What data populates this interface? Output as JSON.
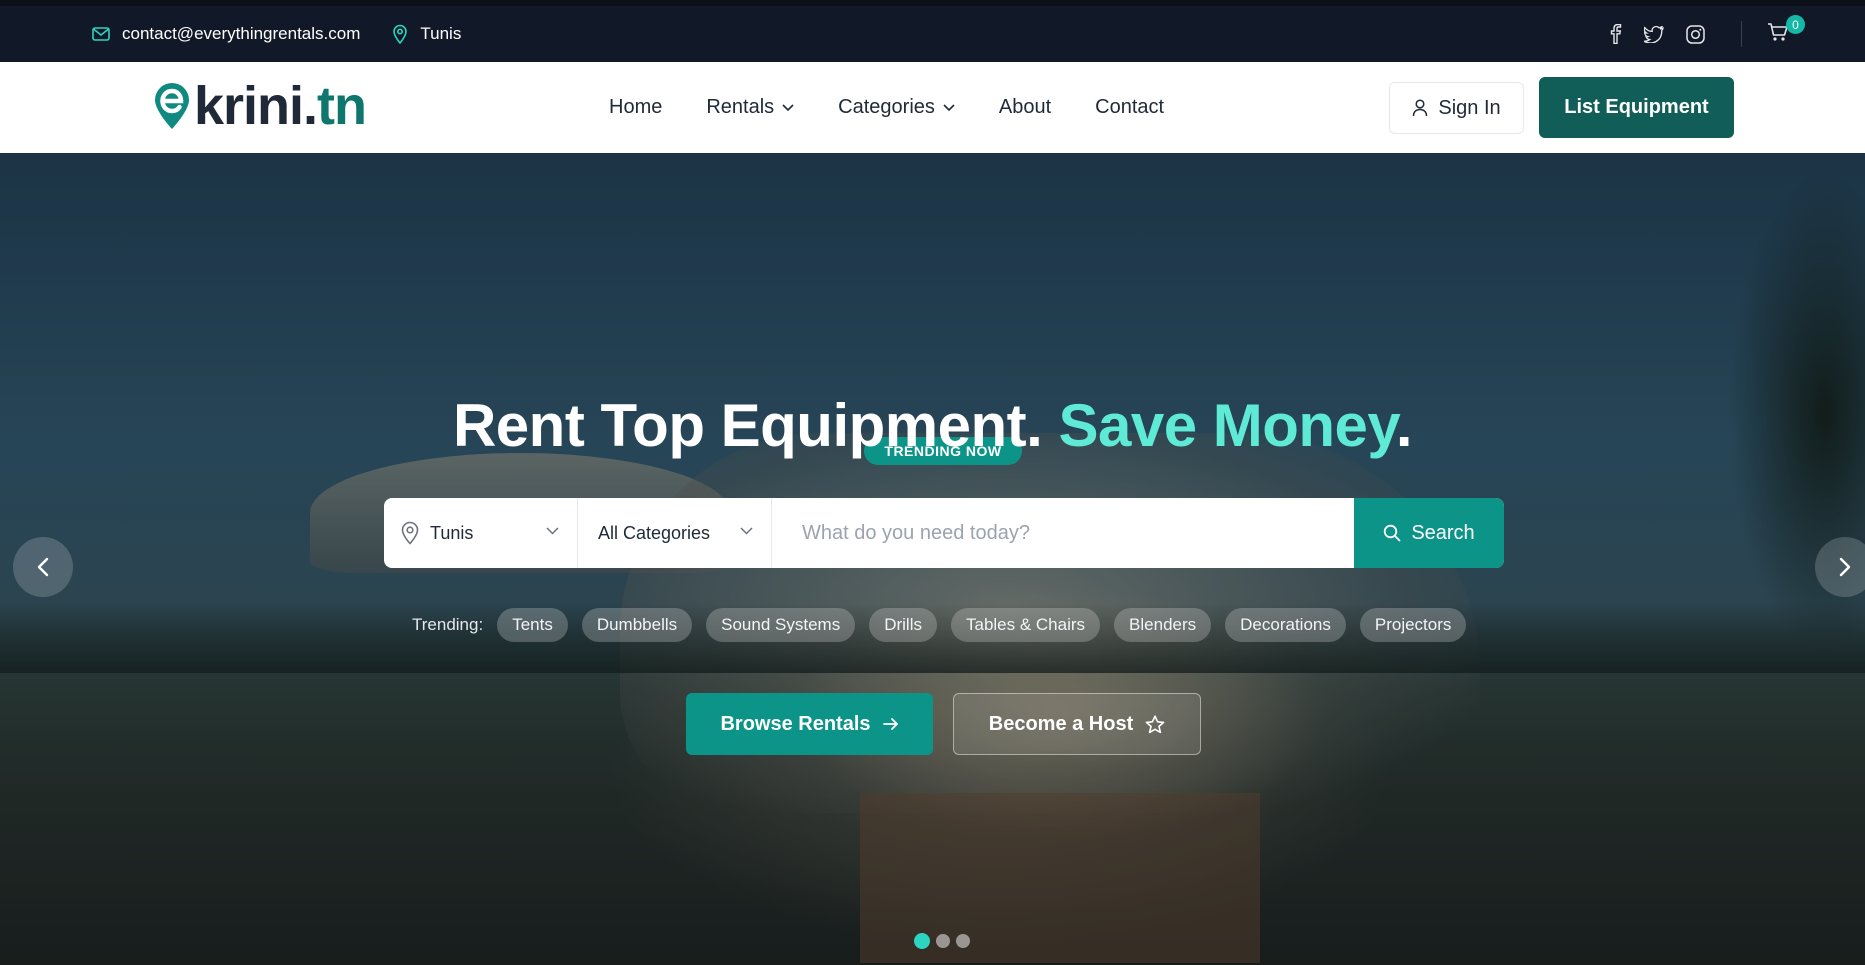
{
  "topbar": {
    "email": "contact@everythingrentals.com",
    "location": "Tunis",
    "icons": [
      "mail-icon",
      "map-pin-icon",
      "facebook-icon",
      "twitter-icon",
      "instagram-icon",
      "shopping-cart-icon"
    ],
    "cart_count": "0"
  },
  "nav": {
    "logo_main": "krini.",
    "logo_tld": "tn",
    "links": [
      {
        "label": "Home"
      },
      {
        "label": "Rentals"
      },
      {
        "label": "Categories"
      },
      {
        "label": "About"
      },
      {
        "label": "Contact"
      }
    ],
    "signin_label": "Sign In",
    "list_label": "List Equipment"
  },
  "hero": {
    "badge": "TRENDING NOW",
    "headline_part1": "Rent Top Equipment. ",
    "headline_accent": "Save Money",
    "headline_end": ".",
    "search": {
      "location_value": "Tunis",
      "category_value": "All Categories",
      "placeholder": "What do you need today?",
      "button_label": "Search"
    },
    "trending_label": "Trending:",
    "trending_items": [
      "Tents",
      "Dumbbells",
      "Sound Systems",
      "Drills",
      "Tables & Chairs",
      "Blenders",
      "Decorations",
      "Projectors"
    ],
    "browse_label": "Browse Rentals",
    "host_label": "Become a Host",
    "slide_count": 3,
    "active_slide": 1
  },
  "colors": {
    "topbar_bg": "#111827",
    "brand_teal": "#0d9488",
    "brand_dark_teal": "#115e59",
    "accent_mint": "#5eead4"
  }
}
